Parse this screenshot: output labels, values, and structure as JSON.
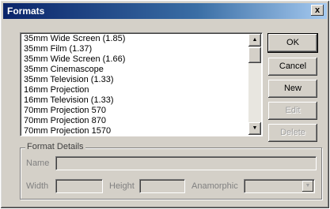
{
  "window": {
    "title": "Formats",
    "close_glyph": "x"
  },
  "list": {
    "items": [
      "35mm Wide Screen (1.85)",
      "35mm Film (1.37)",
      "35mm Wide Screen (1.66)",
      "35mm Cinemascope",
      "35mm Television (1.33)",
      "16mm Projection",
      "16mm Television (1.33)",
      "70mm Projection 570",
      "70mm Projection 870",
      "70mm Projection 1570"
    ],
    "scroll_up_glyph": "▲",
    "scroll_down_glyph": "▼"
  },
  "buttons": {
    "ok": "OK",
    "cancel": "Cancel",
    "new": "New",
    "edit": "Edit",
    "delete": "Delete"
  },
  "details": {
    "group_title": "Format Details",
    "name_label": "Name",
    "width_label": "Width",
    "height_label": "Height",
    "anamorphic_label": "Anamorphic",
    "combo_glyph": "▼"
  }
}
